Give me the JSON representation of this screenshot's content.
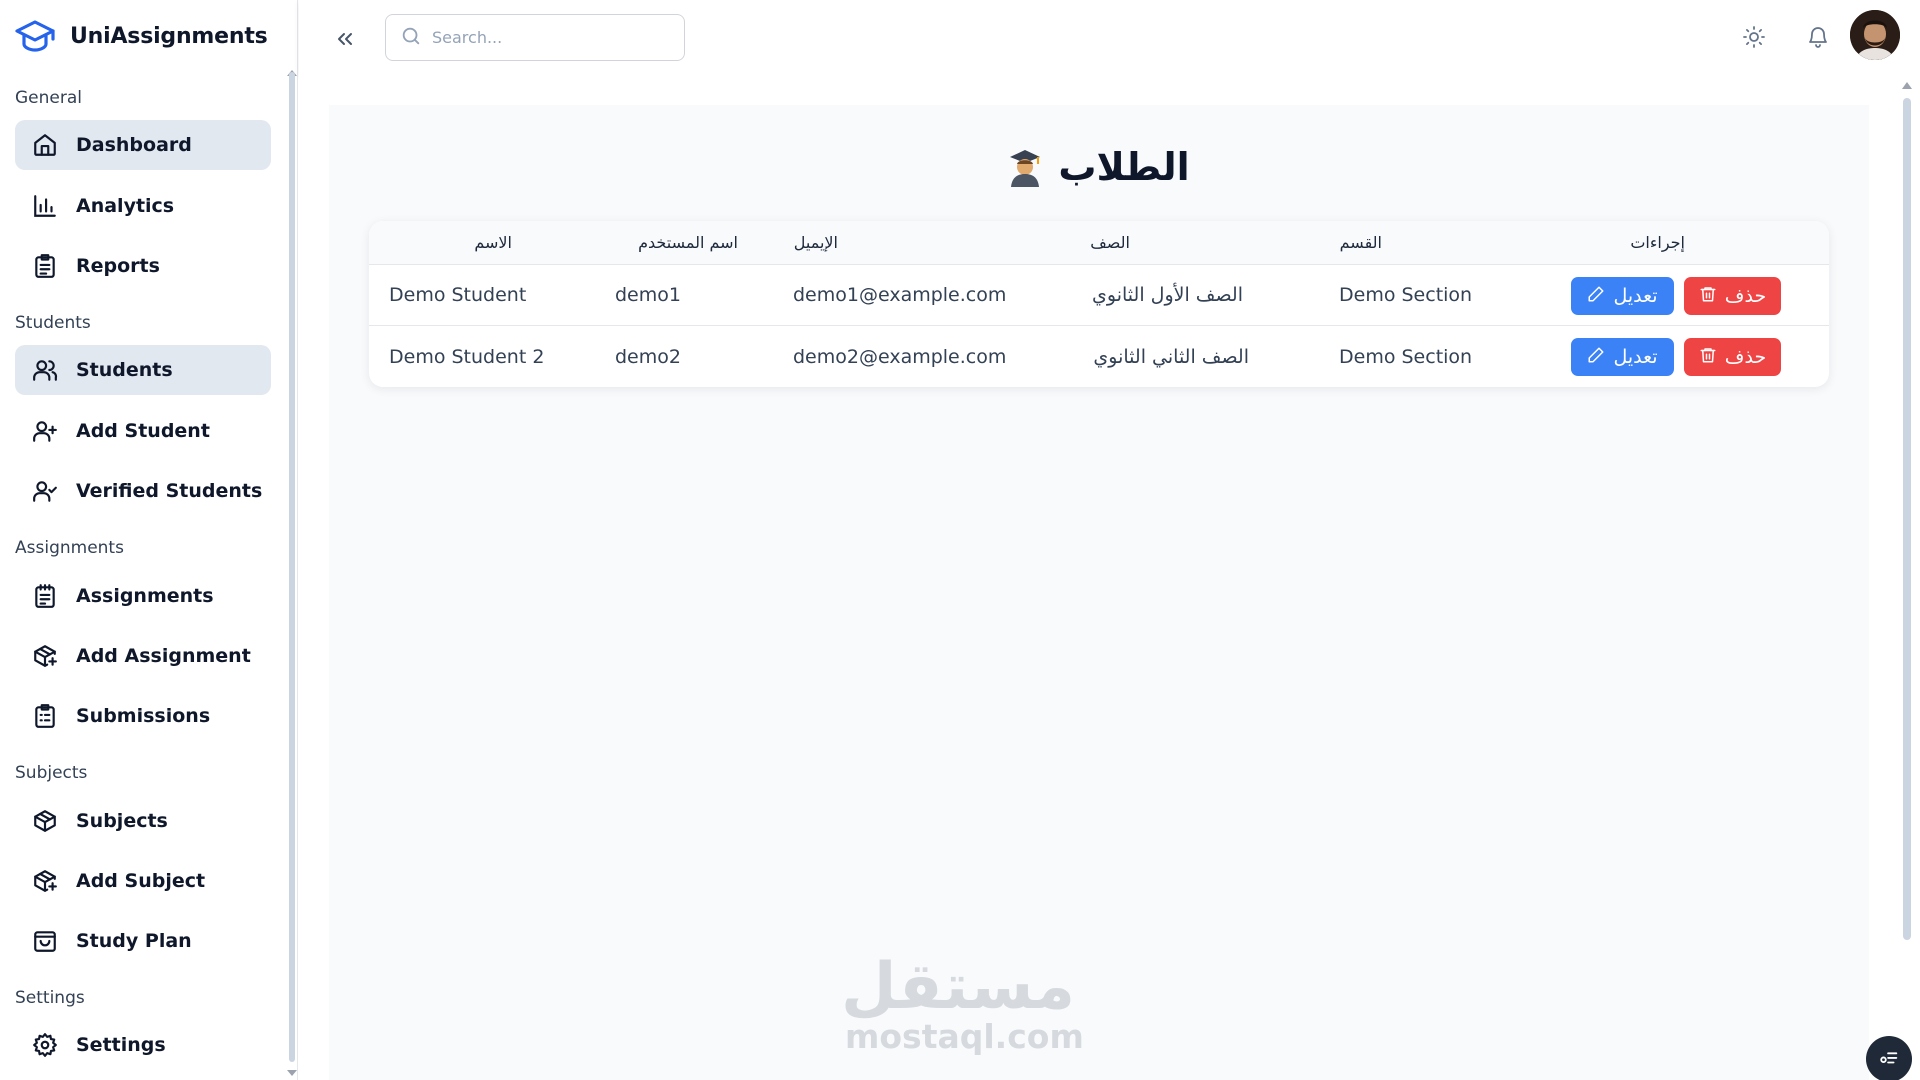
{
  "brand": {
    "name": "UniAssignments",
    "accent": "#2563eb"
  },
  "sidebar": {
    "sections": [
      {
        "label": "General"
      },
      {
        "label": "Students"
      },
      {
        "label": "Assignments"
      },
      {
        "label": "Subjects"
      },
      {
        "label": "Settings"
      }
    ],
    "items": [
      {
        "label": "Dashboard",
        "icon": "home-icon",
        "active": true
      },
      {
        "label": "Analytics",
        "icon": "bar-chart-icon"
      },
      {
        "label": "Reports",
        "icon": "clipboard-icon"
      },
      {
        "label": "Students",
        "icon": "users-icon",
        "active": true
      },
      {
        "label": "Add Student",
        "icon": "user-plus-icon"
      },
      {
        "label": "Verified Students",
        "icon": "user-check-icon"
      },
      {
        "label": "Assignments",
        "icon": "notepad-icon"
      },
      {
        "label": "Add Assignment",
        "icon": "package-plus-icon"
      },
      {
        "label": "Submissions",
        "icon": "clipboard-list-icon"
      },
      {
        "label": "Subjects",
        "icon": "box-icon"
      },
      {
        "label": "Add Subject",
        "icon": "package-plus-icon"
      },
      {
        "label": "Study Plan",
        "icon": "shopping-bag-icon"
      },
      {
        "label": "Settings",
        "icon": "gear-icon"
      }
    ]
  },
  "header": {
    "search_placeholder": "Search...",
    "icons": [
      "double-chevron-left-icon",
      "search-icon",
      "sun-icon",
      "bell-icon",
      "avatar"
    ]
  },
  "page": {
    "title": "الطلاب",
    "title_emoji": "graduate-icon"
  },
  "table": {
    "columns": {
      "name": "الاسم",
      "username": "اسم المستخدم",
      "email": "الإيميل",
      "class": "الصف",
      "section": "القسم",
      "actions": "إجراءات"
    },
    "rows": [
      {
        "name": "Demo Student",
        "username": "demo1",
        "email": "demo1@example.com",
        "class": "الصف الأول الثانوي",
        "section": "Demo Section"
      },
      {
        "name": "Demo Student 2",
        "username": "demo2",
        "email": "demo2@example.com",
        "class": "الصف الثاني الثانوي",
        "section": "Demo Section"
      }
    ],
    "edit_label": "تعديل",
    "delete_label": "حذف",
    "edit_color": "#3b82f6",
    "delete_color": "#ef4444"
  },
  "watermark": {
    "arabic": "مستقل",
    "latin": "mostaql.com"
  }
}
